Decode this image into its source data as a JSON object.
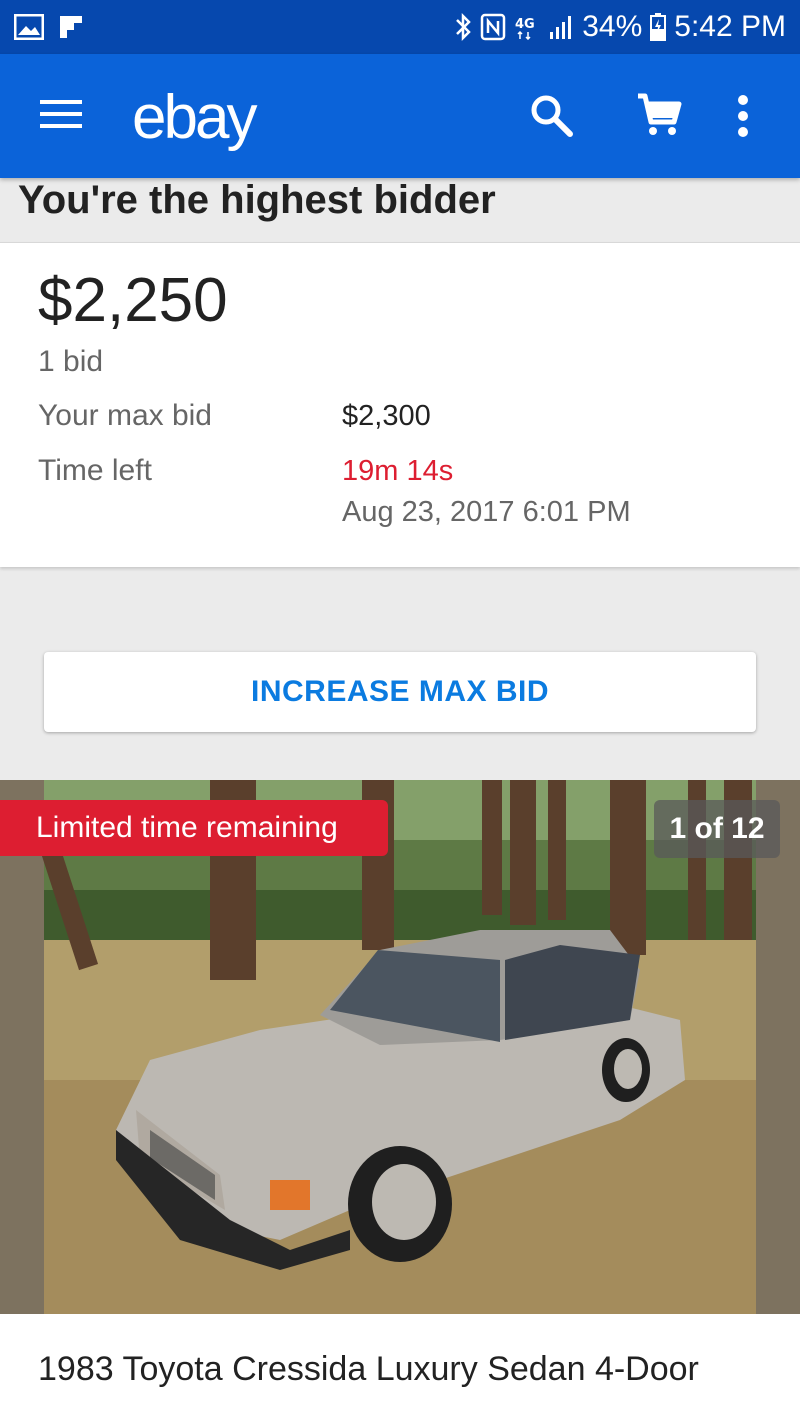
{
  "status_bar": {
    "battery": "34%",
    "time": "5:42 PM",
    "icons": [
      "gallery-icon",
      "flipboard-icon",
      "bluetooth-icon",
      "nfc-icon",
      "4g-icon",
      "signal-icon",
      "battery-charging-icon"
    ]
  },
  "app_bar": {
    "logo": "ebay",
    "icons": [
      "menu-icon",
      "search-icon",
      "cart-icon",
      "more-vert-icon"
    ]
  },
  "bid_status": {
    "header": "You're the highest bidder",
    "price": "$2,250",
    "bid_count": "1 bid",
    "max_bid_label": "Your max bid",
    "max_bid_value": "$2,300",
    "time_left_label": "Time left",
    "time_left_value": "19m 14s",
    "end_date": "Aug 23, 2017 6:01 PM"
  },
  "actions": {
    "increase_max_bid": "INCREASE MAX BID"
  },
  "gallery": {
    "badge": "Limited time remaining",
    "counter": "1 of 12"
  },
  "listing": {
    "title": "1983 Toyota Cressida Luxury Sedan 4-Door"
  },
  "colors": {
    "status_bar": "#0648ae",
    "app_bar": "#0b63d9",
    "accent_blue": "#0b7be0",
    "alert_red": "#dd1e31"
  }
}
